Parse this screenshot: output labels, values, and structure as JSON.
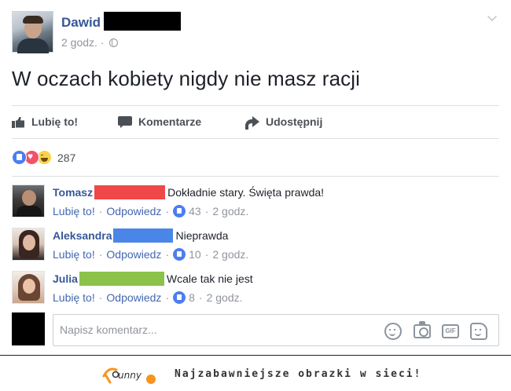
{
  "post": {
    "author": "Dawid",
    "time": "2 godz.",
    "meta_separator": "·",
    "text": "W oczach kobiety nigdy nie masz racji"
  },
  "actions": {
    "like": "Lubię to!",
    "comment": "Komentarze",
    "share": "Udostępnij"
  },
  "reactions": {
    "types": [
      "like",
      "love",
      "haha"
    ],
    "count": "287"
  },
  "comments": [
    {
      "name": "Tomasz",
      "redaction_color": "#f04848",
      "text": "Dokładnie stary. Święta prawda!",
      "like_label": "Lubię to!",
      "reply_label": "Odpowiedz",
      "likes": "43",
      "time": "2 godz."
    },
    {
      "name": "Aleksandra",
      "redaction_color": "#4a86e8",
      "text": "Nieprawda",
      "like_label": "Lubię to!",
      "reply_label": "Odpowiedz",
      "likes": "10",
      "time": "2 godz."
    },
    {
      "name": "Julia",
      "redaction_color": "#8bc34a",
      "text": "Wcale tak nie jest",
      "like_label": "Lubię to!",
      "reply_label": "Odpowiedz",
      "likes": "8",
      "time": "2 godz."
    }
  ],
  "write_comment": {
    "placeholder": "Napisz komentarz...",
    "gif_label": "GIF"
  },
  "footer": {
    "tagline": "Najzabawniejsze obrazki w sieci!",
    "logo_text": "funny"
  },
  "colors": {
    "link_blue": "#365899",
    "accent_orange": "#f7941d"
  }
}
